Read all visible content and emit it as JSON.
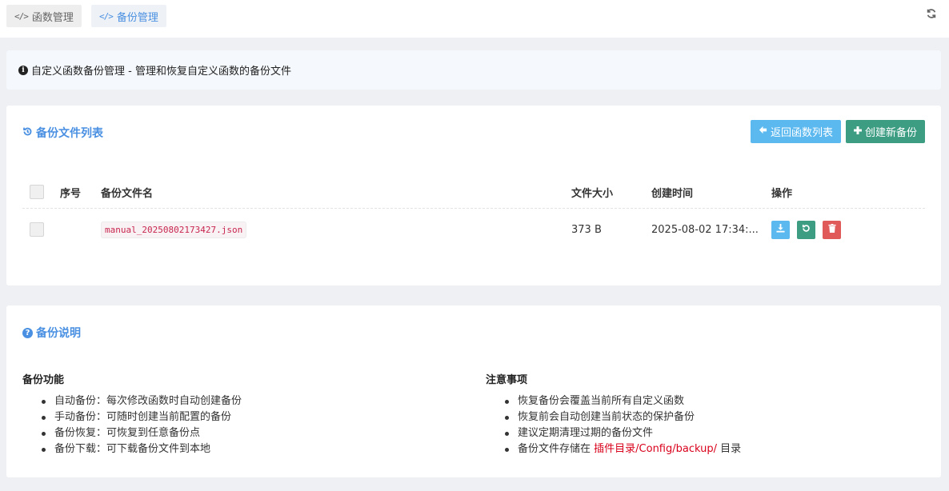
{
  "tabs": [
    {
      "label": "函数管理",
      "active": false
    },
    {
      "label": "备份管理",
      "active": true
    }
  ],
  "info": {
    "text": "自定义函数备份管理 - 管理和恢复自定义函数的备份文件"
  },
  "backup_list": {
    "title": "备份文件列表",
    "back_button": "返回函数列表",
    "new_button": "创建新备份",
    "columns": {
      "index": "序号",
      "filename": "备份文件名",
      "size": "文件大小",
      "created": "创建时间",
      "actions": "操作"
    },
    "rows": [
      {
        "index": "",
        "filename": "manual_20250802173427.json",
        "size": "373 B",
        "created": "2025-08-02 17:34:..."
      }
    ]
  },
  "notes": {
    "title": "备份说明",
    "left_head": "备份功能",
    "left_items": [
      "自动备份：每次修改函数时自动创建备份",
      "手动备份：可随时创建当前配置的备份",
      "备份恢复：可恢复到任意备份点",
      "备份下载：可下载备份文件到本地"
    ],
    "right_head": "注意事项",
    "right_items": [
      "恢复备份会覆盖当前所有自定义函数",
      "恢复前会自动创建当前状态的保护备份",
      "建议定期清理过期的备份文件"
    ],
    "path_prefix": "备份文件存储在",
    "path": "插件目录/Config/backup/",
    "path_suffix": "目录"
  },
  "colors": {
    "accent": "#4a90e2",
    "info_button": "#5bb9f0",
    "success_button": "#3d9d82",
    "danger_button": "#e05a5a",
    "highlight": "#d9001b"
  }
}
